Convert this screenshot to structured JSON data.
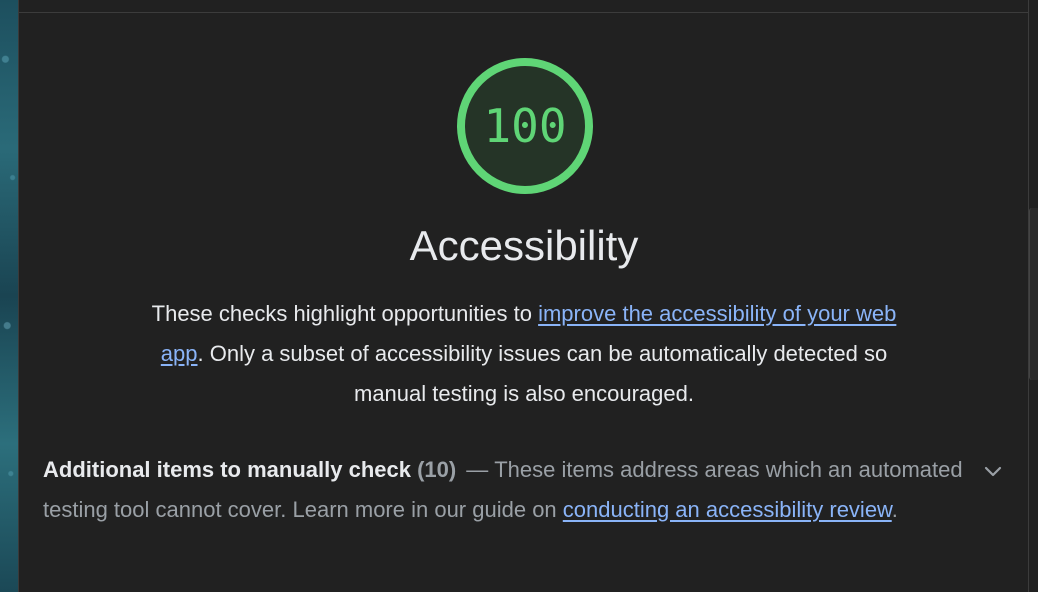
{
  "category": {
    "score": "100",
    "title": "Accessibility",
    "description": {
      "text_before": "These checks highlight opportunities to ",
      "link_text": "improve the accessibility of your web app",
      "text_after": ". Only a subset of accessibility issues can be automatically detected so manual testing is also encouraged."
    },
    "score_fraction": 1.0
  },
  "audit_group": {
    "title": "Additional items to manually check",
    "count": "(10)",
    "separator": "—",
    "description": "These items address areas which an automated testing tool cannot cover. Learn more in our guide on ",
    "link_text": "conducting an accessibility review",
    "suffix": "."
  },
  "colors": {
    "background": "#212121",
    "pass_green": "#5fd576",
    "link": "#8ab4f8",
    "text": "#e8eaed",
    "muted_text": "#9aa0a6"
  },
  "icons": {
    "expand": "chevron-down-icon"
  }
}
